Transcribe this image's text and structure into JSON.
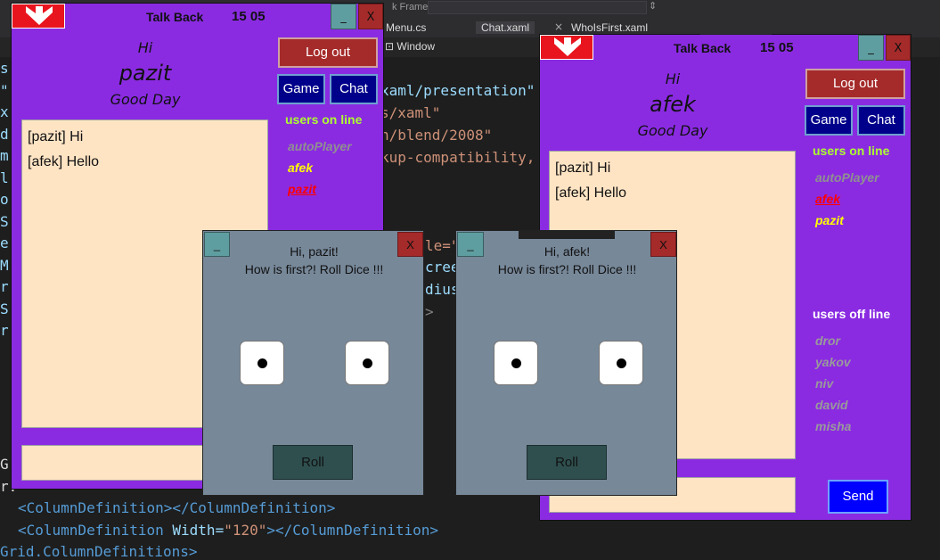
{
  "ide": {
    "frame_label": "k Frame:",
    "tabs": [
      "Menu.cs",
      "Chat.xaml",
      "WhoIsFirst.xaml"
    ],
    "tab_close": "×",
    "sub_item": "Window",
    "gutter_chars": [
      "s",
      "\"",
      "x",
      "d",
      "m",
      "l",
      "o",
      "S",
      "e",
      "M",
      "r",
      "S",
      "r"
    ],
    "code_right": [
      "xaml/presentation\"",
      "s/xaml\"",
      "n/blend/2008\"",
      "kup-compatibility,"
    ],
    "code_behind_dice": [
      "le=\"",
      "cree",
      "dius",
      ">"
    ],
    "bottom_gutter": [
      "G",
      "r."
    ],
    "line1": {
      "open": "<ColumnDefinition>",
      "close": "</ColumnDefinition>"
    },
    "line2": {
      "open": "<ColumnDefinition",
      "attr": " Width=",
      "value": "\"120\"",
      "close": "></ColumnDefinition>"
    },
    "line3": "Grid.ColumnDefinitions>"
  },
  "chat_windows": [
    {
      "title": "Talk Back",
      "time": "15 05",
      "min_label": "_",
      "close_label": "X",
      "greeting": "Hi",
      "username": "pazit",
      "day_text": "Good Day",
      "logout_label": "Log out",
      "game_label": "Game",
      "chat_label": "Chat",
      "online_header": "users on line",
      "online_users": [
        {
          "name": "autoPlayer",
          "state": "grey"
        },
        {
          "name": "afek",
          "state": "yellow"
        },
        {
          "name": "pazit",
          "state": "red"
        }
      ],
      "messages": [
        "[pazit] Hi",
        "[afek] Hello"
      ]
    },
    {
      "title": "Talk Back",
      "time": "15 05",
      "min_label": "_",
      "close_label": "X",
      "greeting": "Hi",
      "username": "afek",
      "day_text": "Good Day",
      "logout_label": "Log out",
      "game_label": "Game",
      "chat_label": "Chat",
      "online_header": "users on line",
      "online_users": [
        {
          "name": "autoPlayer",
          "state": "grey"
        },
        {
          "name": "afek",
          "state": "red"
        },
        {
          "name": "pazit",
          "state": "yellow"
        }
      ],
      "offline_header": "users off line",
      "offline_users": [
        "dror",
        "yakov",
        "niv",
        "david",
        "misha"
      ],
      "messages": [
        "[pazit] Hi",
        "[afek] Hello"
      ],
      "send_label": "Send"
    }
  ],
  "dice_windows": [
    {
      "min_label": "_",
      "close_label": "X",
      "line1": "Hi, pazit!",
      "line2": "How is first?! Roll Dice !!!",
      "dice": [
        1,
        1
      ],
      "roll_label": "Roll"
    },
    {
      "min_label": "_",
      "close_label": "X",
      "line1": "Hi, afek!",
      "line2": "How is first?! Roll Dice !!!",
      "dice": [
        1,
        1
      ],
      "roll_label": "Roll"
    }
  ],
  "colors": {
    "window_bg": "#8a2be2",
    "online_header": "#adff2f",
    "chat_bg": "#ffe4c4",
    "dice_bg": "#778899"
  }
}
